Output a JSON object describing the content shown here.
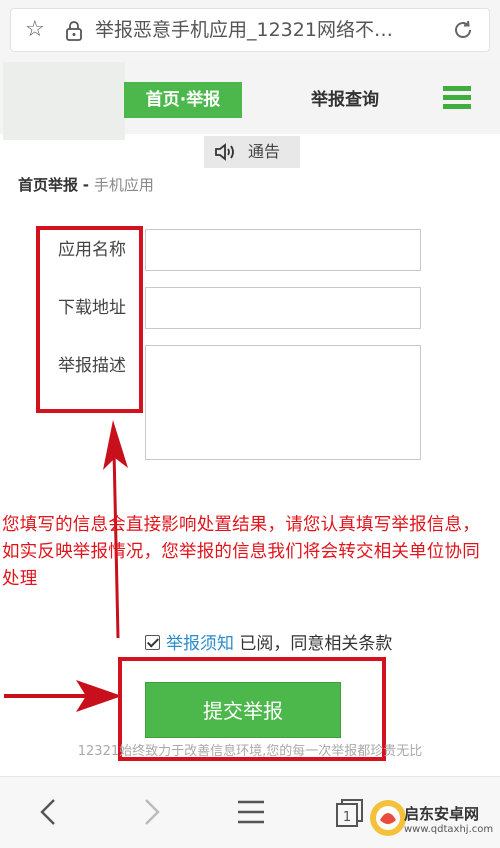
{
  "browser": {
    "url": "举报恶意手机应用_12321网络不…",
    "bottom_nav": {
      "tab_count": "1"
    }
  },
  "header": {
    "nav_home": "首页·举报",
    "nav_query": "举报查询"
  },
  "notice": {
    "label": "通告"
  },
  "breadcrumb": {
    "home": "首页举报",
    "separator": "-",
    "current": "手机应用"
  },
  "form": {
    "app_name_label": "应用名称",
    "app_name_value": "",
    "download_url_label": "下载地址",
    "download_url_value": "",
    "description_label": "举报描述",
    "description_value": ""
  },
  "annotation": {
    "warning_text": "您填写的信息会直接影响处置结果，请您认真填写举报信息，如实反映举报情况，您举报的信息我们将会转交相关单位协同处理"
  },
  "agreement": {
    "checked": true,
    "link_text": "举报须知",
    "text": "已阅，同意相关条款"
  },
  "submit": {
    "label": "提交举报"
  },
  "footer": {
    "slogan": "12321始终致力于改善信息环境,您的每一次举报都珍贵无比"
  },
  "watermark": {
    "name": "启东安卓网",
    "url": "www.qdtaxhj.com"
  },
  "colors": {
    "accent_green": "#4cb84b",
    "annotation_red": "#d4111e",
    "link_blue": "#2a8ccd"
  }
}
